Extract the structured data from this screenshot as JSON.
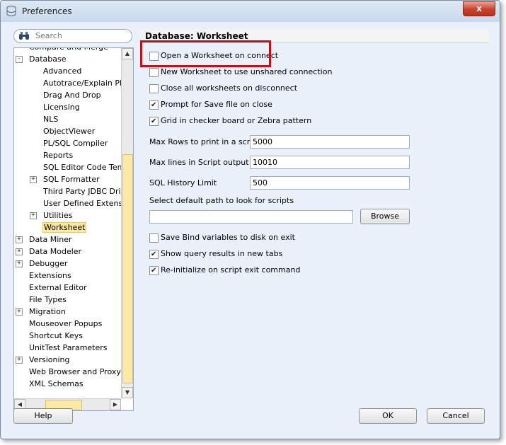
{
  "window": {
    "title": "Preferences",
    "close_glyph": "x"
  },
  "search": {
    "placeholder": "Search"
  },
  "tree": {
    "partial_top": "Compare and Merge",
    "items": [
      {
        "label": "Database",
        "expander": "-"
      },
      {
        "label": "Advanced",
        "expander": ""
      },
      {
        "label": "Autotrace/Explain Plan",
        "expander": ""
      },
      {
        "label": "Drag And Drop",
        "expander": ""
      },
      {
        "label": "Licensing",
        "expander": ""
      },
      {
        "label": "NLS",
        "expander": ""
      },
      {
        "label": "ObjectViewer",
        "expander": ""
      },
      {
        "label": "PL/SQL Compiler",
        "expander": ""
      },
      {
        "label": "Reports",
        "expander": ""
      },
      {
        "label": "SQL Editor Code Templates",
        "expander": ""
      },
      {
        "label": "SQL Formatter",
        "expander": "+"
      },
      {
        "label": "Third Party JDBC Drivers",
        "expander": ""
      },
      {
        "label": "User Defined Extensions",
        "expander": ""
      },
      {
        "label": "Utilities",
        "expander": "+"
      },
      {
        "label": "Worksheet",
        "expander": "",
        "selected": true
      },
      {
        "label": "Data Miner",
        "expander": "+"
      },
      {
        "label": "Data Modeler",
        "expander": "+"
      },
      {
        "label": "Debugger",
        "expander": "+"
      },
      {
        "label": "Extensions",
        "expander": ""
      },
      {
        "label": "External Editor",
        "expander": ""
      },
      {
        "label": "File Types",
        "expander": ""
      },
      {
        "label": "Migration",
        "expander": "+"
      },
      {
        "label": "Mouseover Popups",
        "expander": ""
      },
      {
        "label": "Shortcut Keys",
        "expander": ""
      },
      {
        "label": "UnitTest Parameters",
        "expander": ""
      },
      {
        "label": "Versioning",
        "expander": "+"
      },
      {
        "label": "Web Browser and Proxy",
        "expander": ""
      },
      {
        "label": "XML Schemas",
        "expander": ""
      }
    ]
  },
  "panel": {
    "title": "Database: Worksheet",
    "checkboxes_top": [
      {
        "label": "Open a Worksheet on connect",
        "checked": false
      },
      {
        "label": "New Worksheet to use unshared connection",
        "checked": false
      },
      {
        "label": "Close all worksheets on disconnect",
        "checked": false
      },
      {
        "label": "Prompt for Save file on close",
        "checked": true
      },
      {
        "label": "Grid in checker board or Zebra pattern",
        "checked": true
      }
    ],
    "fields": [
      {
        "label": "Max Rows to print in a script",
        "value": "5000"
      },
      {
        "label": "Max lines in Script output",
        "value": "10010"
      },
      {
        "label": "SQL History Limit",
        "value": "500"
      }
    ],
    "path_label": "Select default path to look for scripts",
    "path_value": "",
    "browse_label": "Browse",
    "checkboxes_bottom": [
      {
        "label": "Save Bind variables to disk on exit",
        "checked": false
      },
      {
        "label": "Show query results in new tabs",
        "checked": true
      },
      {
        "label": "Re-initialize on script exit command",
        "checked": true
      }
    ]
  },
  "buttons": {
    "help": "Help",
    "ok": "OK",
    "cancel": "Cancel"
  },
  "colors": {
    "highlight_box": "#b8141a",
    "selection": "#fbe9a5"
  }
}
